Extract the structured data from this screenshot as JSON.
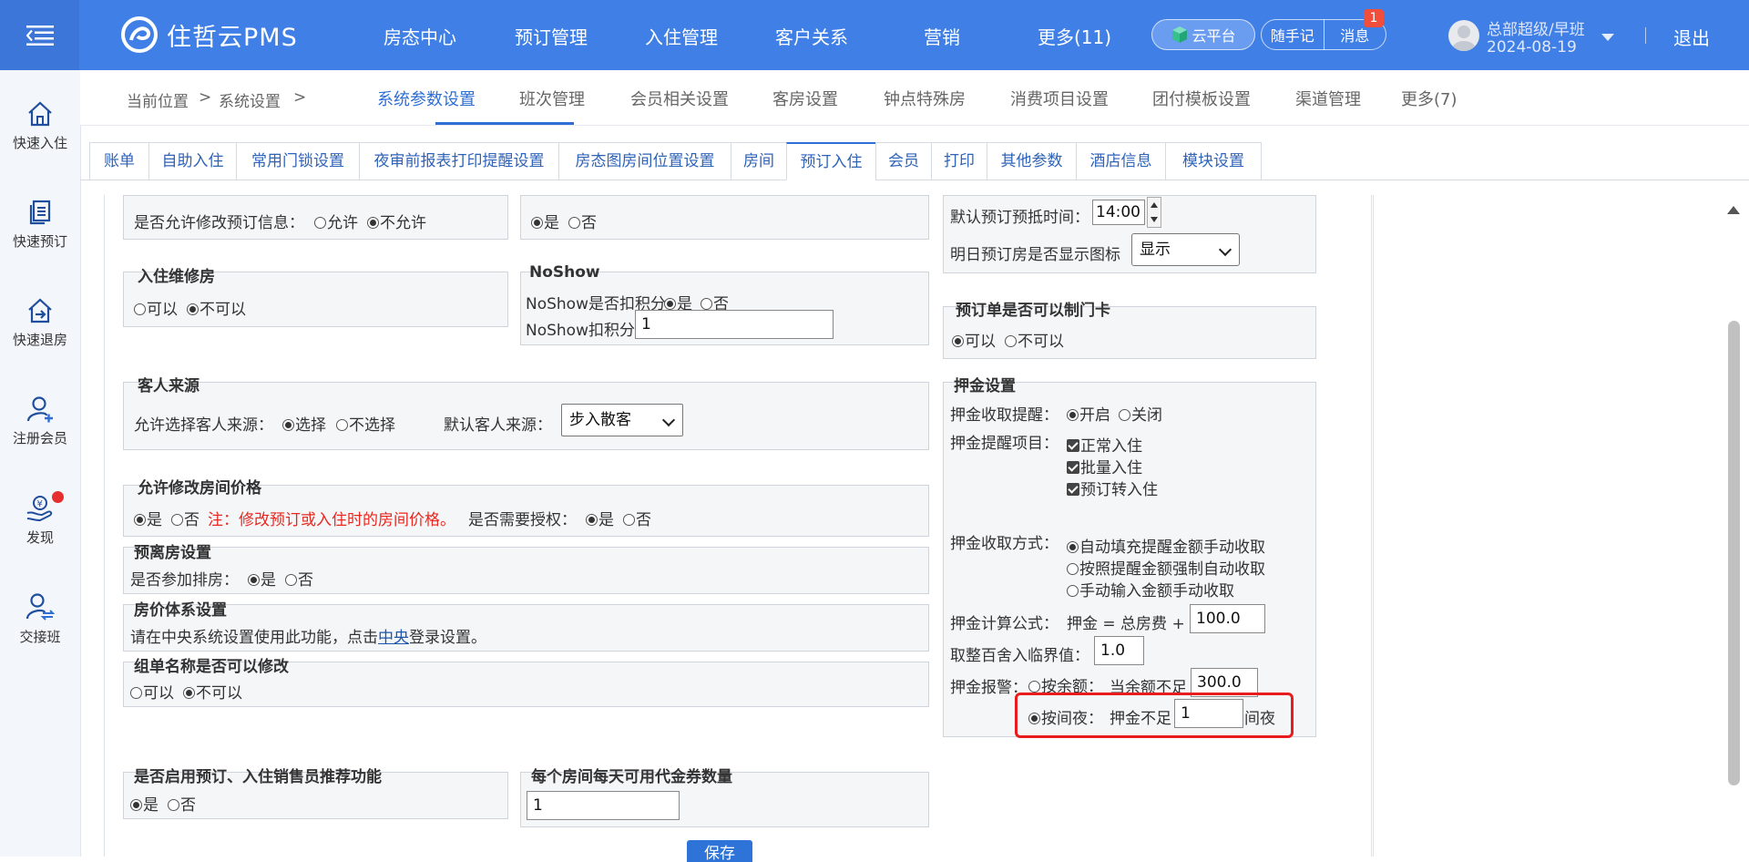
{
  "header": {
    "brand": "住哲云PMS",
    "nav": [
      "房态中心",
      "预订管理",
      "入住管理",
      "客户关系",
      "营销",
      "更多(11)"
    ],
    "cloud_label": "云平台",
    "notes_label": "随手记",
    "messages_label": "消息",
    "messages_badge": "1",
    "user_name": "总部超级/早班",
    "user_date": "2024-08-19",
    "logout": "退出"
  },
  "sidebar": {
    "items": [
      "快速入住",
      "快速预订",
      "快速退房",
      "注册会员",
      "发现",
      "交接班"
    ]
  },
  "breadcrumb": {
    "current": "当前位置",
    "sep1": ">",
    "section": "系统设置",
    "sep2": ">"
  },
  "top_tabs": [
    "系统参数设置",
    "班次管理",
    "会员相关设置",
    "客房设置",
    "钟点特殊房",
    "消费项目设置",
    "团付模板设置",
    "渠道管理",
    "更多(7)"
  ],
  "sub_tabs": [
    "账单",
    "自助入住",
    "常用门锁设置",
    "夜审前报表打印提醒设置",
    "房态图房间位置设置",
    "房间",
    "预订入住",
    "会员",
    "打印",
    "其他参数",
    "酒店信息",
    "模块设置"
  ],
  "form": {
    "modify_booking": {
      "label": "是否允许修改预订信息：",
      "opt_allow": "允许",
      "opt_disallow": "不允许"
    },
    "top_middle": {
      "opt_yes": "是",
      "opt_no": "否"
    },
    "default_arrival": {
      "label": "默认预订预抵时间：",
      "value": "14:00"
    },
    "tomorrow_icon": {
      "label": "明日预订房是否显示图标",
      "value": "显示"
    },
    "checkin_repair": {
      "title": "入住维修房",
      "opt_can": "可以",
      "opt_cannot": "不可以"
    },
    "noshow": {
      "title": "NoShow",
      "deduct_label": "NoShow是否扣积分",
      "opt_yes": "是",
      "opt_no": "否",
      "points_label": "NoShow扣积分",
      "points_value": "1"
    },
    "booking_card": {
      "title": "预订单是否可以制门卡",
      "opt_can": "可以",
      "opt_cannot": "不可以"
    },
    "guest_source": {
      "title": "客人来源",
      "allow_label": "允许选择客人来源：",
      "opt_select": "选择",
      "opt_noselect": "不选择",
      "default_label": "默认客人来源：",
      "default_value": "步入散客"
    },
    "deposit": {
      "title": "押金设置",
      "remind_label": "押金收取提醒：",
      "opt_on": "开启",
      "opt_off": "关闭",
      "items_label": "押金提醒项目：",
      "items": [
        "正常入住",
        "批量入住",
        "预订转入住"
      ],
      "method_label": "押金收取方式：",
      "methods": [
        "自动填充提醒金额手动收取",
        "按照提醒金额强制自动收取",
        "手动输入金额手动收取"
      ],
      "formula_label": "押金计算公式：",
      "formula_text": "押金 = 总房费 +",
      "formula_value": "100.0",
      "round_label": "取整百舍入临界值：",
      "round_value": "1.0",
      "alarm_label": "押金报警：",
      "by_balance": "按余额：",
      "balance_text": "当余额不足",
      "balance_value": "300.0",
      "by_night": "按间夜：",
      "night_text": "押金不足",
      "night_value": "1",
      "night_unit": "间夜"
    },
    "modify_price": {
      "title": "允许修改房间价格",
      "opt_yes": "是",
      "opt_no": "否",
      "note": "注：修改预订或入住时的房间价格。",
      "auth_label": "是否需要授权：",
      "auth_yes": "是",
      "auth_no": "否"
    },
    "pre_departure": {
      "title": "预离房设置",
      "label": "是否参加排房：",
      "opt_yes": "是",
      "opt_no": "否"
    },
    "price_system": {
      "title": "房价体系设置",
      "text_before": "请在中央系统设置使用此功能，点击",
      "link": "中央",
      "text_after": "登录设置。"
    },
    "group_name": {
      "title": "组单名称是否可以修改",
      "opt_can": "可以",
      "opt_cannot": "不可以"
    },
    "salesperson": {
      "title": "是否启用预订、入住销售员推荐功能",
      "opt_yes": "是",
      "opt_no": "否"
    },
    "coupons": {
      "title": "每个房间每天可用代金券数量",
      "value": "1"
    },
    "save": "保存"
  },
  "colors": {
    "primary": "#3f7fe6",
    "accent": "#2f6fd5",
    "highlight": "#e81c1c",
    "note": "#e8281f"
  }
}
